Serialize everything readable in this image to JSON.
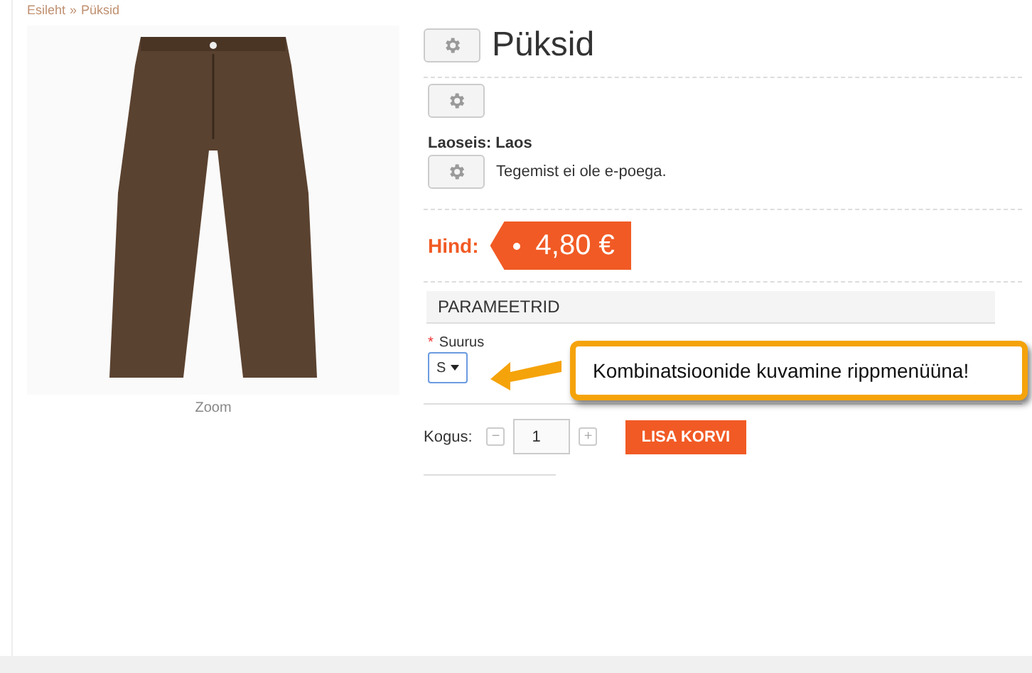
{
  "breadcrumb": {
    "items": [
      "Esileht",
      "Püksid"
    ],
    "separator": "»"
  },
  "image": {
    "caption": "Zoom"
  },
  "product": {
    "title": "Püksid",
    "stock": "Laoseis: Laos",
    "notice": "Tegemist ei ole e-poega.",
    "price_label": "Hind:",
    "price": "4,80 €",
    "parameters_heading": "PARAMEETRID",
    "attribute": {
      "label": "Suurus",
      "required": true,
      "required_mark": "*",
      "value": "S"
    },
    "quantity": {
      "label": "Kogus:",
      "value": "1",
      "minus": "−",
      "plus": "+"
    },
    "add_button": "LISA KORVI"
  },
  "callout": {
    "text": "Kombinatsioonide kuvamine rippmenüüna!"
  }
}
